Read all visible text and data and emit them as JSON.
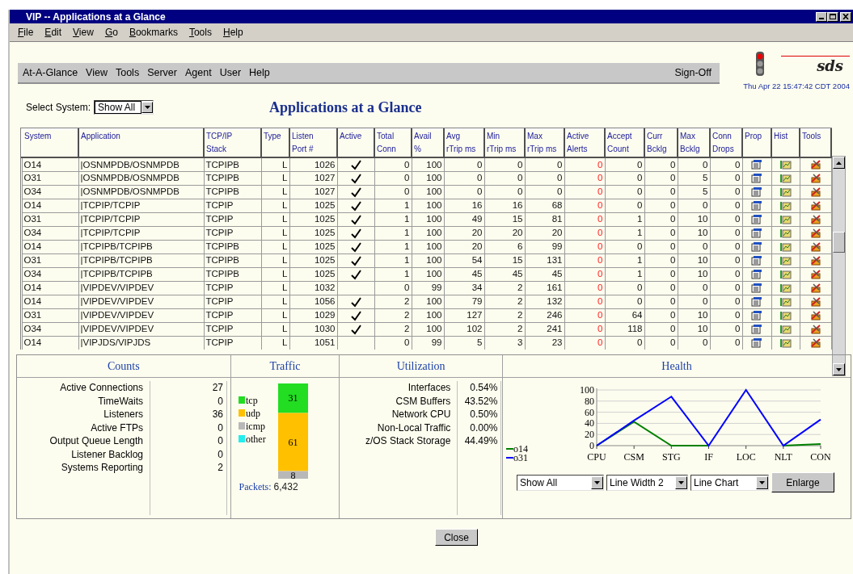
{
  "window": {
    "title": "VIP -- Applications at a Glance"
  },
  "menu_bar": [
    "File",
    "Edit",
    "View",
    "Go",
    "Bookmarks",
    "Tools",
    "Help"
  ],
  "nav_bar": {
    "items": [
      "At-A-Glance",
      "View",
      "Tools",
      "Server",
      "Agent",
      "User",
      "Help"
    ],
    "sign_off": "Sign-Off"
  },
  "logo": {
    "text": "sds"
  },
  "timestamp": "Thu Apr 22 15:47:42 CDT 2004",
  "select_system": {
    "label": "Select System:",
    "value": "Show All"
  },
  "page_title": "Applications at a Glance",
  "table": {
    "columns": [
      {
        "label": "System",
        "kind": "text"
      },
      {
        "label": "Application",
        "kind": "text"
      },
      {
        "label": "TCP/IP\nStack",
        "kind": "text"
      },
      {
        "label": "Type",
        "kind": "number"
      },
      {
        "label": "Listen\nPort #",
        "kind": "number"
      },
      {
        "label": "Active",
        "kind": "check"
      },
      {
        "label": "Total\nConn",
        "kind": "number"
      },
      {
        "label": "Avail\n%",
        "kind": "number"
      },
      {
        "label": "Avg\nrTrip ms",
        "kind": "number"
      },
      {
        "label": "Min\nrTrip ms",
        "kind": "number"
      },
      {
        "label": "Max\nrTrip ms",
        "kind": "number"
      },
      {
        "label": "Active\nAlerts",
        "kind": "alert"
      },
      {
        "label": "Accept\nCount",
        "kind": "number"
      },
      {
        "label": "Curr\nBcklg",
        "kind": "number"
      },
      {
        "label": "Max\nBcklg",
        "kind": "number"
      },
      {
        "label": "Conn\nDrops",
        "kind": "number"
      },
      {
        "label": "Prop",
        "kind": "properties"
      },
      {
        "label": "Hist",
        "kind": "history"
      },
      {
        "label": "Tools",
        "kind": "tools"
      }
    ],
    "rows": [
      {
        "active": true,
        "cells": [
          "O14",
          "|OSNMPDB/OSNMPDB",
          "TCPIPB",
          "L",
          "1026",
          "",
          "0",
          "100",
          "0",
          "0",
          "0",
          "0",
          "0",
          "0",
          "0",
          "0"
        ]
      },
      {
        "active": true,
        "cells": [
          "O31",
          "|OSNMPDB/OSNMPDB",
          "TCPIPB",
          "L",
          "1027",
          "",
          "0",
          "100",
          "0",
          "0",
          "0",
          "0",
          "0",
          "0",
          "5",
          "0"
        ]
      },
      {
        "active": true,
        "cells": [
          "O34",
          "|OSNMPDB/OSNMPDB",
          "TCPIPB",
          "L",
          "1027",
          "",
          "0",
          "100",
          "0",
          "0",
          "0",
          "0",
          "0",
          "0",
          "5",
          "0"
        ]
      },
      {
        "active": true,
        "cells": [
          "O14",
          "|TCPIP/TCPIP",
          "TCPIP",
          "L",
          "1025",
          "",
          "1",
          "100",
          "16",
          "16",
          "68",
          "0",
          "0",
          "0",
          "0",
          "0"
        ]
      },
      {
        "active": true,
        "cells": [
          "O31",
          "|TCPIP/TCPIP",
          "TCPIP",
          "L",
          "1025",
          "",
          "1",
          "100",
          "49",
          "15",
          "81",
          "0",
          "1",
          "0",
          "10",
          "0"
        ]
      },
      {
        "active": true,
        "cells": [
          "O34",
          "|TCPIP/TCPIP",
          "TCPIP",
          "L",
          "1025",
          "",
          "1",
          "100",
          "20",
          "20",
          "20",
          "0",
          "1",
          "0",
          "10",
          "0"
        ]
      },
      {
        "active": true,
        "cells": [
          "O14",
          "|TCPIPB/TCPIPB",
          "TCPIPB",
          "L",
          "1025",
          "",
          "1",
          "100",
          "20",
          "6",
          "99",
          "0",
          "0",
          "0",
          "0",
          "0"
        ]
      },
      {
        "active": true,
        "cells": [
          "O31",
          "|TCPIPB/TCPIPB",
          "TCPIPB",
          "L",
          "1025",
          "",
          "1",
          "100",
          "54",
          "15",
          "131",
          "0",
          "1",
          "0",
          "10",
          "0"
        ]
      },
      {
        "active": true,
        "cells": [
          "O34",
          "|TCPIPB/TCPIPB",
          "TCPIPB",
          "L",
          "1025",
          "",
          "1",
          "100",
          "45",
          "45",
          "45",
          "0",
          "1",
          "0",
          "10",
          "0"
        ]
      },
      {
        "active": false,
        "cells": [
          "O14",
          "|VIPDEV/VIPDEV",
          "TCPIP",
          "L",
          "1032",
          "",
          "0",
          "99",
          "34",
          "2",
          "161",
          "0",
          "0",
          "0",
          "0",
          "0"
        ]
      },
      {
        "active": true,
        "cells": [
          "O14",
          "|VIPDEV/VIPDEV",
          "TCPIP",
          "L",
          "1056",
          "",
          "2",
          "100",
          "79",
          "2",
          "132",
          "0",
          "0",
          "0",
          "0",
          "0"
        ]
      },
      {
        "active": true,
        "cells": [
          "O31",
          "|VIPDEV/VIPDEV",
          "TCPIP",
          "L",
          "1029",
          "",
          "2",
          "100",
          "127",
          "2",
          "246",
          "0",
          "64",
          "0",
          "10",
          "0"
        ]
      },
      {
        "active": true,
        "cells": [
          "O34",
          "|VIPDEV/VIPDEV",
          "TCPIP",
          "L",
          "1030",
          "",
          "2",
          "100",
          "102",
          "2",
          "241",
          "0",
          "118",
          "0",
          "10",
          "0"
        ]
      },
      {
        "active": false,
        "cells": [
          "O14",
          "|VIPJDS/VIPJDS",
          "TCPIP",
          "L",
          "1051",
          "",
          "0",
          "99",
          "5",
          "3",
          "23",
          "0",
          "0",
          "0",
          "0",
          "0"
        ]
      }
    ]
  },
  "counts": {
    "title": "Counts",
    "rows": [
      {
        "label": "Active Connections",
        "value": "27"
      },
      {
        "label": "TimeWaits",
        "value": "0"
      },
      {
        "label": "Listeners",
        "value": "36"
      },
      {
        "label": "Active FTPs",
        "value": "0"
      },
      {
        "label": "Output Queue Length",
        "value": "0"
      },
      {
        "label": "Listener Backlog",
        "value": "0"
      },
      {
        "label": "Systems Reporting",
        "value": "2"
      }
    ]
  },
  "traffic": {
    "title": "Traffic",
    "packets_label": "Packets:",
    "packets_value": "6,432",
    "segments": [
      {
        "name": "tcp",
        "color": "#22dd22",
        "value": "31"
      },
      {
        "name": "udp",
        "color": "#ffc000",
        "value": "61"
      },
      {
        "name": "icmp",
        "color": "#b8b8b8",
        "value": "8"
      },
      {
        "name": "other",
        "color": "#22eeee"
      }
    ]
  },
  "utilization": {
    "title": "Utilization",
    "rows": [
      {
        "label": "Interfaces",
        "value": "0.54%"
      },
      {
        "label": "CSM Buffers",
        "value": "43.52%"
      },
      {
        "label": "Network CPU",
        "value": "0.50%"
      },
      {
        "label": "Non-Local Traffic",
        "value": "0.00%"
      },
      {
        "label": "z/OS Stack Storage",
        "value": "44.49%"
      }
    ]
  },
  "health": {
    "title": "Health",
    "chart_data": {
      "type": "line",
      "categories": [
        "CPU",
        "CSM",
        "STG",
        "IF",
        "LOC",
        "NLT",
        "CON"
      ],
      "ylim": [
        0,
        100
      ],
      "yticks": [
        0,
        20,
        40,
        60,
        80,
        100
      ],
      "grid": true,
      "legend": "left",
      "series": [
        {
          "name": "o14",
          "color": "#008000",
          "values": [
            0,
            43,
            0,
            0,
            null,
            0,
            3
          ]
        },
        {
          "name": "o31",
          "color": "#0000ff",
          "values": [
            0,
            45,
            88,
            0,
            100,
            0,
            47
          ]
        }
      ]
    },
    "selects": [
      "Show All",
      "Line Width 2",
      "Line Chart"
    ],
    "enlarge": "Enlarge"
  },
  "close_button": "Close"
}
